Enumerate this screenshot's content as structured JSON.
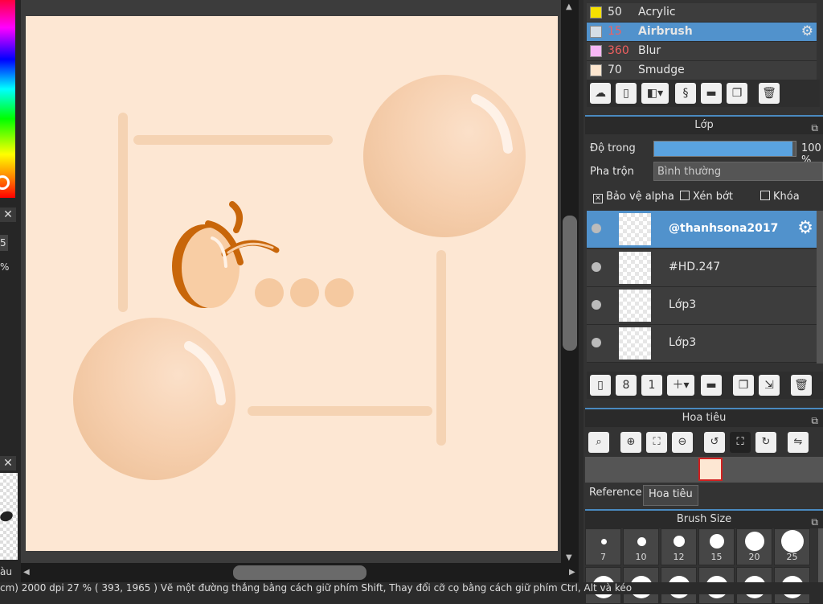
{
  "left": {
    "input_value": "5",
    "percent": "%",
    "color_label": "àu"
  },
  "brushes": [
    {
      "num": "50",
      "name": "Acrylic",
      "color": "#f5e000",
      "num_color": "#e6e6e6",
      "selected": false
    },
    {
      "num": "15",
      "name": "Airbrush",
      "color": "#d5dde5",
      "num_color": "#f06060",
      "selected": true
    },
    {
      "num": "360",
      "name": "Blur",
      "color": "#f7b7f5",
      "num_color": "#f06060",
      "selected": false
    },
    {
      "num": "70",
      "name": "Smudge",
      "color": "#fde6cf",
      "num_color": "#e6e6e6",
      "selected": false
    }
  ],
  "layer_panel": {
    "title": "Lớp",
    "opacity_label": "Độ trong",
    "opacity_value": "100 %",
    "opacity_fraction": 0.98,
    "blend_label": "Pha trộn",
    "blend_value": "Bình thường",
    "protect_alpha": "Bảo vệ alpha",
    "clipping": "Xén bớt",
    "lock": "Khóa",
    "layers": [
      {
        "name": "@thanhsona2017",
        "selected": true
      },
      {
        "name": "#HD.247",
        "selected": false
      },
      {
        "name": "Lớp3",
        "selected": false
      },
      {
        "name": "Lớp3",
        "selected": false
      }
    ]
  },
  "navigator": {
    "title": "Hoa tiêu",
    "tabs": [
      "Reference",
      "Hoa tiêu"
    ]
  },
  "brush_size": {
    "title": "Brush Size",
    "sizes": [
      "7",
      "10",
      "12",
      "15",
      "20",
      "25"
    ]
  },
  "status": {
    "text": "cm)  2000 dpi   27 %   ( 393, 1965 )   Vẽ một đường thẳng bằng cách giữ phím Shift, Thay đổi cỡ cọ bằng cách giữ phím Ctrl, Alt và kéo"
  },
  "colors": {
    "accent": "#5192cc",
    "canvas_bg": "#fde7d3",
    "peach": "#f5c9a0",
    "orange": "#c8660a"
  }
}
